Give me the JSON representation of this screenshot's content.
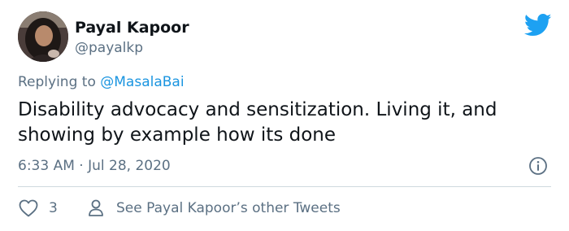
{
  "author": {
    "name": "Payal Kapoor",
    "handle": "@payalkp",
    "avatar_icon": "profile-photo"
  },
  "brand": {
    "icon": "twitter-bird-icon",
    "color": "#1da1f2"
  },
  "reply": {
    "prefix": "Replying to ",
    "mention": "@MasalaBai"
  },
  "tweet": {
    "text": "Disability advocacy and sensitization. Living it, and showing by example how its done",
    "timestamp": "6:33 AM · Jul 28, 2020"
  },
  "actions": {
    "like_count": "3",
    "see_more": "See Payal Kapoor’s other Tweets"
  },
  "colors": {
    "text": "#0f1419",
    "secondary": "#5b7083",
    "link": "#1b95e0",
    "divider": "#cfd9de"
  }
}
